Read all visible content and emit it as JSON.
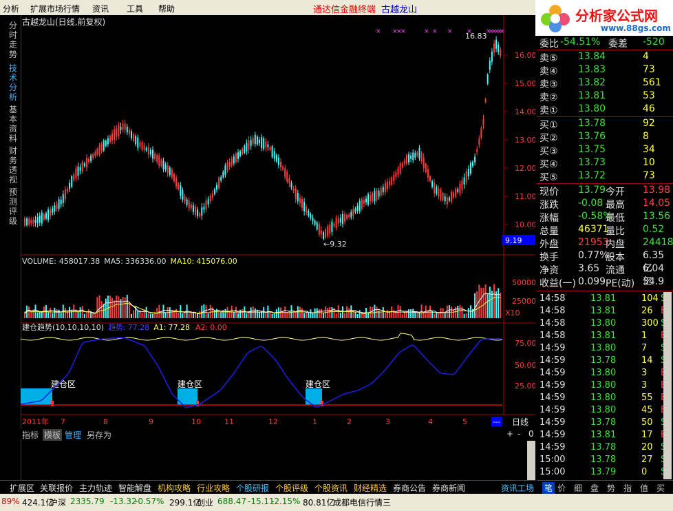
{
  "menubar": {
    "items": [
      "分析",
      "扩展市场行情",
      "资讯",
      "工具",
      "帮助"
    ],
    "title_left": "通达信金融终端",
    "title_stock": "古越龙山"
  },
  "logo": {
    "main": "分析家公式网",
    "url": "www.88gs.com"
  },
  "side_tabs": [
    "分时走势",
    "技术分析",
    "基本资料",
    "财务透视",
    "预测评级"
  ],
  "chart": {
    "header": "古越龙山(日线,前复权)",
    "high_label": "16.83",
    "low_label": "9.32",
    "price_ticks": [
      "16.00",
      "15.00",
      "14.00",
      "13.00",
      "12.00",
      "11.00",
      "10.00"
    ],
    "current_price_tag": "9.19",
    "volume": {
      "label": "VOLUME:",
      "value": "458017.38",
      "ma5_label": "MA5:",
      "ma5": "336336.00",
      "ma10_label": "MA10:",
      "ma10": "415076.00",
      "ticks": [
        "50000",
        "25000"
      ],
      "unit": "X10"
    },
    "indicator": {
      "title": "建仓趋势(10,10,10,10)",
      "k1": "趋势:",
      "v1": "77.28",
      "k2": "A1:",
      "v2": "77.28",
      "k3": "A2:",
      "v3": "0.00",
      "ticks": [
        "75.00",
        "50.00",
        "25.00"
      ],
      "zone_label": "建仓区"
    },
    "xaxis": [
      "2011年",
      "7",
      "8",
      "9",
      "10",
      "11",
      "12",
      "1",
      "2",
      "3",
      "4",
      "5"
    ],
    "period": "日线",
    "colors": {
      "up": "#ff3c3c",
      "down": "#40ffff",
      "trend": "#1e1ee6",
      "a1": "#ffff80",
      "zone": "#00aee6"
    }
  },
  "bottom_tabs": [
    "指标",
    "模板",
    "管理",
    "另存为"
  ],
  "zoom": [
    "+",
    "-",
    "0"
  ],
  "subbar": [
    {
      "t": "扩展区",
      "c": "white"
    },
    {
      "t": "关联报价",
      "c": "white"
    },
    {
      "t": "主力轨迹",
      "c": "white"
    },
    {
      "t": "智能解盘",
      "c": "white"
    },
    {
      "t": "机构攻略",
      "c": "gold"
    },
    {
      "t": "行业攻略",
      "c": "gold"
    },
    {
      "t": "个股研报",
      "c": "cyan"
    },
    {
      "t": "个股评级",
      "c": "gold"
    },
    {
      "t": "个股资讯",
      "c": "gold"
    },
    {
      "t": "财经精选",
      "c": "gold"
    },
    {
      "t": "券商公告",
      "c": "white"
    },
    {
      "t": "券商新闻",
      "c": "white"
    }
  ],
  "right_tabs": [
    "资讯工场",
    "笔",
    "价",
    "细",
    "盘",
    "势",
    "指",
    "值",
    "买"
  ],
  "orderbook": {
    "ratio_label": "委比",
    "ratio": "-54.51%",
    "diff_label": "委差",
    "diff": "-520",
    "sell": [
      {
        "label": "卖⑤",
        "price": "13.84",
        "vol": "4"
      },
      {
        "label": "卖④",
        "price": "13.83",
        "vol": "73"
      },
      {
        "label": "卖③",
        "price": "13.82",
        "vol": "561"
      },
      {
        "label": "卖②",
        "price": "13.81",
        "vol": "53"
      },
      {
        "label": "卖①",
        "price": "13.80",
        "vol": "46"
      }
    ],
    "buy": [
      {
        "label": "买①",
        "price": "13.78",
        "vol": "92"
      },
      {
        "label": "买②",
        "price": "13.76",
        "vol": "8"
      },
      {
        "label": "买③",
        "price": "13.75",
        "vol": "34"
      },
      {
        "label": "买④",
        "price": "13.73",
        "vol": "10"
      },
      {
        "label": "买⑤",
        "price": "13.72",
        "vol": "73"
      }
    ]
  },
  "quote": [
    {
      "l1": "现价",
      "v1": "13.79",
      "c1": "green",
      "l2": "今开",
      "v2": "13.98",
      "c2": "red"
    },
    {
      "l1": "涨跌",
      "v1": "-0.08",
      "c1": "green",
      "l2": "最高",
      "v2": "14.05",
      "c2": "red"
    },
    {
      "l1": "涨幅",
      "v1": "-0.58%",
      "c1": "green",
      "l2": "最低",
      "v2": "13.56",
      "c2": "green"
    },
    {
      "l1": "总量",
      "v1": "46371",
      "c1": "yellow",
      "l2": "量比",
      "v2": "0.52",
      "c2": "green"
    },
    {
      "l1": "外盘",
      "v1": "21953",
      "c1": "red",
      "l2": "内盘",
      "v2": "24418",
      "c2": "green"
    },
    {
      "l1": "换手",
      "v1": "0.77%",
      "c1": "white",
      "l2": "股本",
      "v2": "6.35亿",
      "c2": "white"
    },
    {
      "l1": "净资",
      "v1": "3.65",
      "c1": "white",
      "l2": "流通",
      "v2": "6.04亿",
      "c2": "white"
    },
    {
      "l1": "收益(一)",
      "v1": "0.099",
      "c1": "white",
      "l2": "PE(动)",
      "v2": "34.9",
      "c2": "white"
    }
  ],
  "ticks": [
    {
      "t": "14:58",
      "p": "13.81",
      "v": "104",
      "s": "S"
    },
    {
      "t": "14:58",
      "p": "13.81",
      "v": "26",
      "s": "B"
    },
    {
      "t": "14:58",
      "p": "13.80",
      "v": "300",
      "s": "S"
    },
    {
      "t": "14:58",
      "p": "13.81",
      "v": "1",
      "s": "B"
    },
    {
      "t": "14:59",
      "p": "13.80",
      "v": "7",
      "s": "S"
    },
    {
      "t": "14:59",
      "p": "13.78",
      "v": "14",
      "s": "S"
    },
    {
      "t": "14:59",
      "p": "13.80",
      "v": "3",
      "s": "B"
    },
    {
      "t": "14:59",
      "p": "13.80",
      "v": "3",
      "s": "B"
    },
    {
      "t": "14:59",
      "p": "13.80",
      "v": "55",
      "s": "B"
    },
    {
      "t": "14:59",
      "p": "13.80",
      "v": "45",
      "s": "B"
    },
    {
      "t": "14:59",
      "p": "13.78",
      "v": "50",
      "s": "S"
    },
    {
      "t": "14:59",
      "p": "13.81",
      "v": "17",
      "s": "B"
    },
    {
      "t": "14:59",
      "p": "13.78",
      "v": "20",
      "s": "S"
    },
    {
      "t": "15:00",
      "p": "13.78",
      "v": "27",
      "s": "S"
    },
    {
      "t": "15:00",
      "p": "13.79",
      "v": "0",
      "s": "S"
    }
  ],
  "statusbar": [
    {
      "t": "89%",
      "c": "red"
    },
    {
      "t": "424.1亿",
      "c": "black"
    },
    {
      "t": "沪深",
      "c": "black"
    },
    {
      "t": "2335.79",
      "c": "green"
    },
    {
      "t": "-13.32",
      "c": "green"
    },
    {
      "t": "-0.57%",
      "c": "green"
    },
    {
      "t": "299.1亿",
      "c": "black"
    },
    {
      "t": "创业",
      "c": "black"
    },
    {
      "t": "688.47",
      "c": "green"
    },
    {
      "t": "-15.11",
      "c": "green"
    },
    {
      "t": "-2.15%",
      "c": "green"
    },
    {
      "t": "80.81亿",
      "c": "black"
    },
    {
      "t": "成都电信行情三",
      "c": "black"
    }
  ]
}
